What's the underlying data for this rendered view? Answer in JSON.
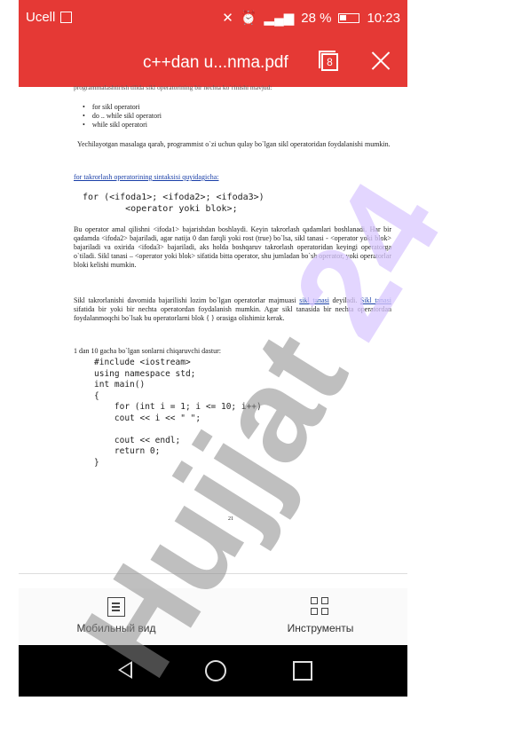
{
  "status_bar": {
    "carrier": "Ucell",
    "battery": "28 %",
    "time": "10:23"
  },
  "title_bar": {
    "title": "c++dan u...nma.pdf",
    "page_count": "8"
  },
  "document": {
    "top_cut_line": "programmalashtirish tilida sikl operatorining bir nechta ko`rinishi mavjud:",
    "bullets": [
      "for sikl operatori",
      "do .. while  sikl operatori",
      "while  sikl operatori"
    ],
    "para1": "Yechilayotgan  masalaga qarab, programmist o`zi uchun qulay bo`lgan sikl operatoridan foydalanishi  mumkin.",
    "syntax_heading": "for takrorlash operatorining sintaksisi quyidagicha:",
    "syntax_line1": "for (<ifoda1>; <ifoda2>; <ifoda3>)",
    "syntax_line2": "        <operator yoki blok>;",
    "para2": "Bu operator amal qilishni <ifoda1> bajarishdan boshlaydi. Keyin takrorlash qadamlari boshlanadi. Har bir qadamda <ifoda2> bajariladi, agar natija 0 dan farqli yoki rost (true) bo`lsa, sikl tanasi - <operator yoki blok> bajariladi va oxirida <ifoda3> bajariladi, aks holda boshqaruv takrorlash operatoridan keyingi operatorga o`tiladi. Sikl tanasi – <operator yoki blok> sifatida bitta operator, shu jumladan bo`sh operator, yoki operatorlar bloki kelishi  mumkin.",
    "para3_a": "Sikl takrorlanishi davomida bajarilishi lozim bo`lgan operatorlar majmuasi ",
    "para3_link1": "sikl tanasi",
    "para3_b": " deyiladi. ",
    "para3_link2": "Sikl tanasi",
    "para3_c": " sifatida bir yoki bir nechta operatordan foydalanish mumkin. Agar sikl tanasida bir nechta operatordan foydalanmoqchi bo`lsak bu operatorlarni blok { } orasiga olishimiz  kerak.",
    "code_intro": "1 dan 10 gacha bo`lgan sonlarni chiqaruvchi dastur:",
    "code": "#include <iostream>\nusing namespace std;\nint main()\n{\n    for (int i = 1; i <= 10; i++)\n    cout << i << \" \";\n\n    cout << endl;\n    return 0;\n}",
    "page_number": "21"
  },
  "toolbar": {
    "mobile_label": "Мобильный вид",
    "tools_label": "Инструменты"
  },
  "watermark": {
    "text": "Hujjat24",
    "color": "#8a8a8a",
    "accent": "#d9c8ff"
  },
  "colors": {
    "brand_red": "#e53935",
    "link_blue": "#1a3fa8"
  }
}
